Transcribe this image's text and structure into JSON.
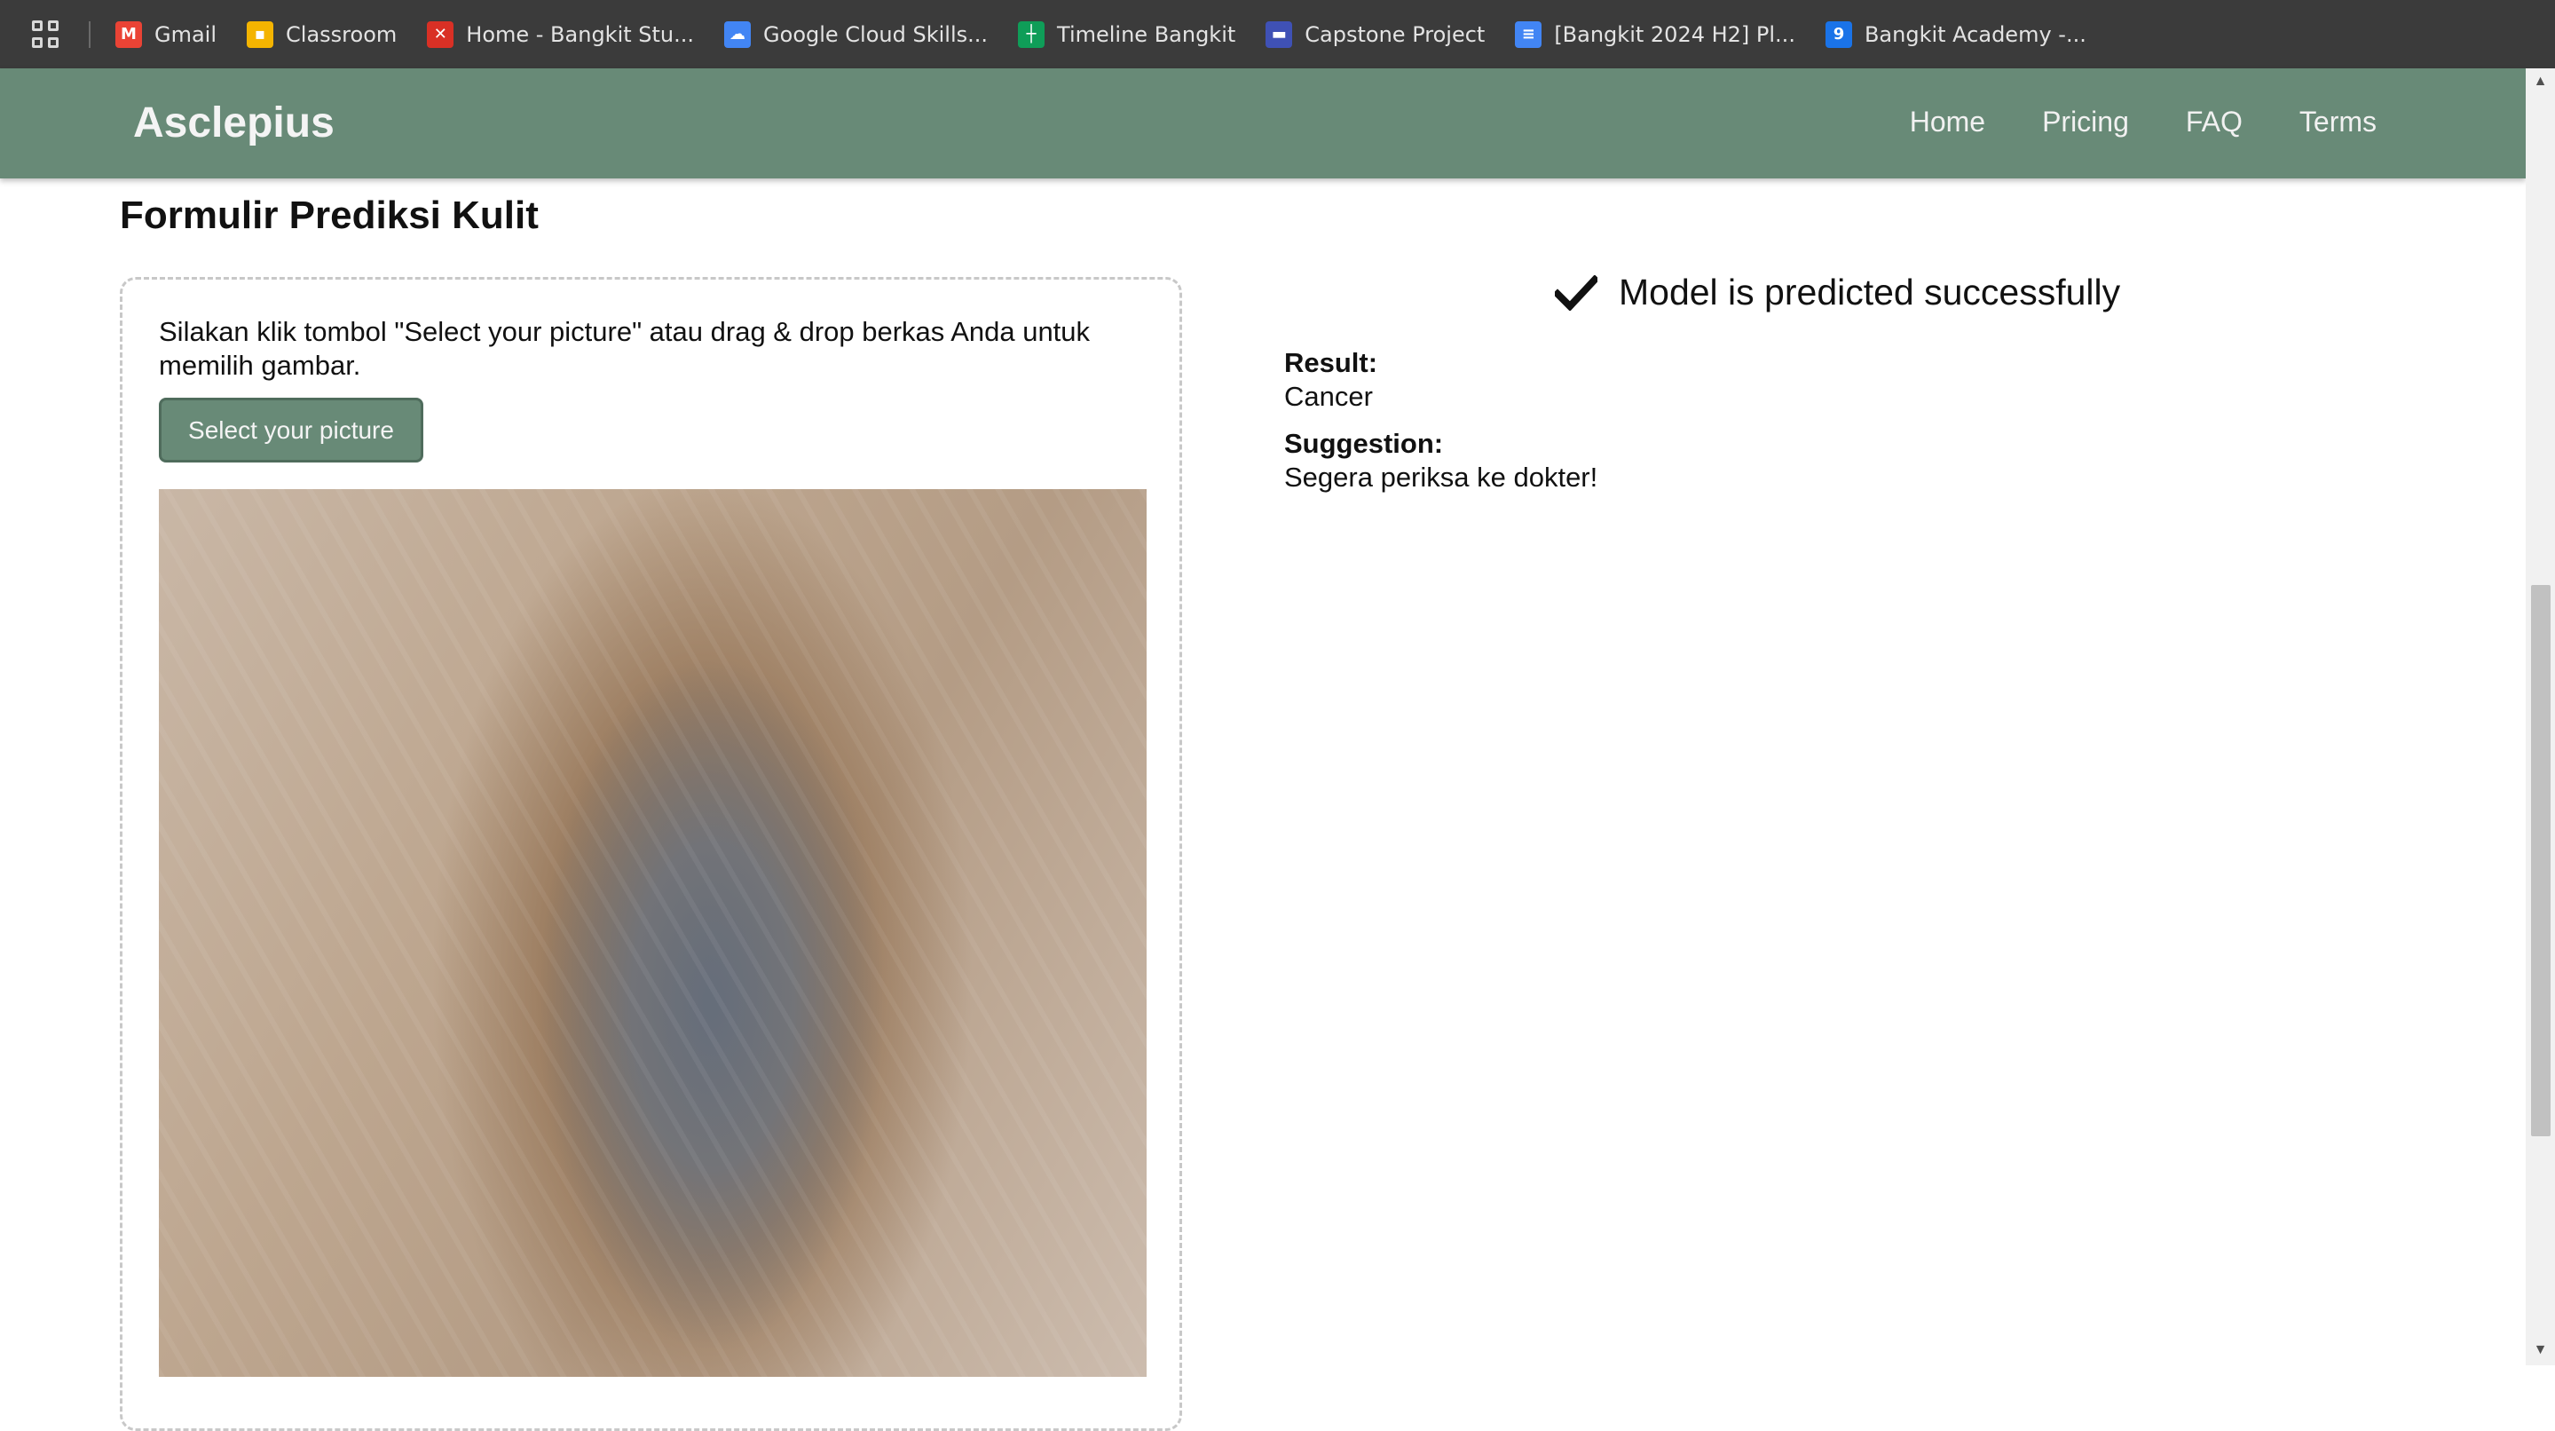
{
  "bookmarks": [
    {
      "label": "Gmail",
      "icon": "gmail-icon",
      "color": "#ea4335",
      "glyph": "M"
    },
    {
      "label": "Classroom",
      "icon": "classroom-icon",
      "color": "#f4b400",
      "glyph": "▪"
    },
    {
      "label": "Home - Bangkit Stu...",
      "icon": "bangkit-icon",
      "color": "#d93025",
      "glyph": "✕"
    },
    {
      "label": "Google Cloud Skills...",
      "icon": "google-cloud-icon",
      "color": "#4285f4",
      "glyph": "☁"
    },
    {
      "label": "Timeline Bangkit",
      "icon": "sheets-icon",
      "color": "#0f9d58",
      "glyph": "┼"
    },
    {
      "label": "Capstone Project",
      "icon": "forms-icon",
      "color": "#3f51b5",
      "glyph": "▬"
    },
    {
      "label": "[Bangkit 2024 H2] Pl...",
      "icon": "docs-icon",
      "color": "#4285f4",
      "glyph": "≡"
    },
    {
      "label": "Bangkit Academy -...",
      "icon": "calendar-icon",
      "color": "#1a73e8",
      "glyph": "9"
    }
  ],
  "navbar": {
    "brand": "Asclepius",
    "links": [
      "Home",
      "Pricing",
      "FAQ",
      "Terms"
    ]
  },
  "form": {
    "title": "Formulir Prediksi Kulit",
    "instructions": "Silakan klik tombol \"Select your picture\" atau drag & drop berkas Anda untuk memilih gambar.",
    "select_button": "Select your picture"
  },
  "result": {
    "status": "Model is predicted successfully",
    "result_label": "Result:",
    "result_value": "Cancer",
    "suggestion_label": "Suggestion:",
    "suggestion_value": "Segera periksa ke dokter!"
  },
  "colors": {
    "accent": "#688a77",
    "bookmarks_bar": "#3b3b3b"
  }
}
